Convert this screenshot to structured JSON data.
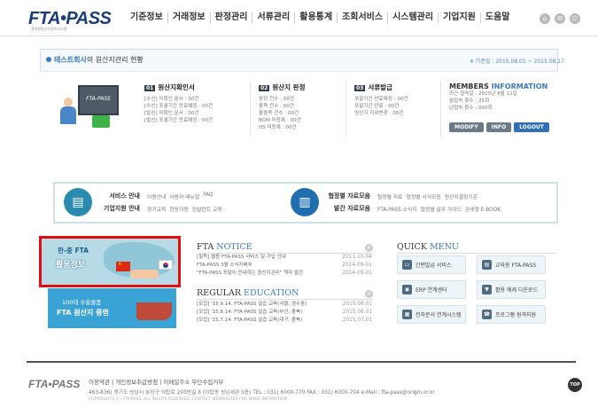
{
  "header": {
    "logo": "FTA•PASS",
    "logo_sub": "관세청원산지관리시스템",
    "nav": [
      "기준정보",
      "거래정보",
      "판정관리",
      "서류관리",
      "활용통계",
      "조회서비스",
      "시스템관리",
      "기업지원",
      "도움말"
    ],
    "icons": [
      "home-icon",
      "mail-icon",
      "power-icon"
    ]
  },
  "status": {
    "company": "테스트회사",
    "title_suffix": "의 원산지관리 현황",
    "period": "※ 기준일 : 2015.08.01 ~ 2015.08.17",
    "illus_text": "FTA-PASS",
    "col1": {
      "num": "01",
      "title": "원산지확인서",
      "lines": [
        "[수신] 미확인 문서 : 00건",
        "[수신] 포괄기간 만료예정 : 00건",
        "[발신] 미확인 문서 : 00건",
        "[발신] 포괄기간 만료예정 : 00건"
      ]
    },
    "col2": {
      "num": "02",
      "title": "원산지 판정",
      "lines": [
        "판정 건수 : 00건",
        "충족 건수 : 00건",
        "불충족 건수 : 00건",
        "BOM 미등록 : 00건",
        "HS 미등록 : 00건"
      ]
    },
    "col3": {
      "num": "03",
      "title": "서류발급",
      "lines": [
        "포괄기간 만료예정 : 00건",
        "포괄기간 만료 : 00건",
        "원산지 지위변경 : 00건"
      ]
    },
    "members": {
      "title_a": "MEMBERS ",
      "title_b": "INFORMATION",
      "lines": [
        "최근 접속일 : 2015년 8월 11일",
        "월접속 횟수 : 25회",
        "년접속 횟수 : 000회"
      ],
      "buttons": [
        "MODIFY",
        "INFO",
        "LOGOUT"
      ]
    }
  },
  "services": {
    "left": {
      "label1": "서비스 안내",
      "links1": [
        "이용안내",
        "사용자 매뉴얼",
        "FAQ"
      ],
      "label2": "기업지원 안내",
      "links2": [
        "정기교육",
        "현장지원",
        "컨설턴트 교육"
      ]
    },
    "right": {
      "label1": "협정별 자료모음",
      "links1": [
        "협정별 자료",
        "협정별 서식모음",
        "원산지결정기준"
      ],
      "label2": "발간 자료모음",
      "links2": [
        "FTA-PASS 소식지",
        "협정별 실무 가이드",
        "관세청 E-BOOK"
      ]
    }
  },
  "banners": {
    "b1_line1": "한-중 FTA",
    "b1_line2": "활용정보",
    "b2_line1": "100대 수출물품",
    "b2_line2": "FTA 원산지 증명"
  },
  "notice": {
    "title_a": "FTA ",
    "title_b": "NOTICE",
    "items": [
      {
        "text": "[필독] 웹용 FTA-PASS 서비스 및 가입 안내",
        "date": "2011-10-04"
      },
      {
        "text": "FTA-PASS 3월 소식지배부",
        "date": "2014-09-01"
      },
      {
        "text": "\"FTA-PASS 포탈이 안내하는 원산지관리\" 책자 발간",
        "date": "2014-09-01"
      }
    ]
  },
  "education": {
    "title_a": "REGULAR ",
    "title_b": "EDUCATION",
    "items": [
      {
        "text": "[모집] '15.9.14. FTA-PASS 실습 교육(서울, 경수종)",
        "date": "2015.08.01"
      },
      {
        "text": "[모집] '15.8.14. FTA-PASS 실습 교육(부산, 충북)",
        "date": "2015.08.01"
      },
      {
        "text": "[모집] '15.7.14. FTA-PASS 실습 교육(대구, 충북)",
        "date": "2015.07.01"
      }
    ]
  },
  "quick": {
    "title_a": "QUICK ",
    "title_b": "MENU",
    "items": [
      {
        "label": "간편발급 서비스",
        "icon": "printer-icon"
      },
      {
        "label": "교육용 FTA-PASS",
        "icon": "book-icon"
      },
      {
        "label": "ERP 연계센터",
        "icon": "erp-icon"
      },
      {
        "label": "활용 예제 다운로드",
        "icon": "download-icon"
      },
      {
        "label": "전자문서 연계시스템",
        "icon": "chart-icon"
      },
      {
        "label": "프로그램 원격지원",
        "icon": "remote-icon"
      }
    ]
  },
  "footer": {
    "logo": "FTA•PASS",
    "links": "이용약관  |  개인정보취급방침  |  이메일주소 무단수집거부",
    "address": "463-836) 경기도 성남시 분당구 야탑로 205번길 8 (야탑동 성남세관 5층)  TEL : 031) 6000-770  FAX : 031) 6000-704  e-Mail : fta-pass@origin.or.kr",
    "copyright": "COPYRIGHTS (C) FTA-PASS. ALL RIGHTS RESERVED. CONTACT WEBMASTER FOR MORE INFOMATION",
    "top_label": "TOP"
  }
}
